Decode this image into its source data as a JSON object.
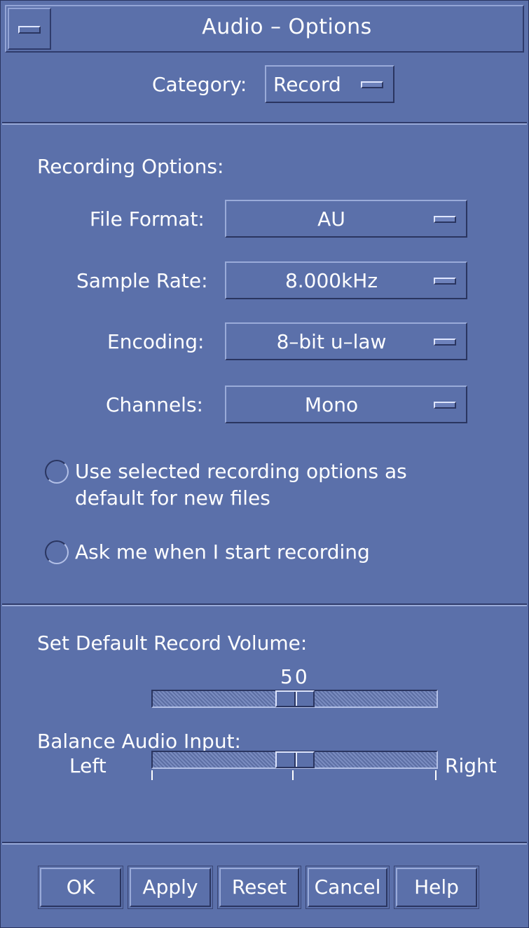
{
  "window": {
    "title": "Audio – Options"
  },
  "category": {
    "label": "Category:",
    "value": "Record"
  },
  "recording": {
    "heading": "Recording Options:",
    "file_format": {
      "label": "File Format:",
      "value": "AU"
    },
    "sample_rate": {
      "label": "Sample Rate:",
      "value": "8.000kHz"
    },
    "encoding": {
      "label": "Encoding:",
      "value": "8–bit u–law"
    },
    "channels": {
      "label": "Channels:",
      "value": "Mono"
    },
    "radio_default_line1": "Use selected recording options as",
    "radio_default_line2": "default for new files",
    "radio_ask": "Ask me when I start recording",
    "radio_default_selected": false,
    "radio_ask_selected": false
  },
  "volume": {
    "heading": "Set Default Record Volume:",
    "value_text": "50",
    "value": 50,
    "max": 100
  },
  "balance": {
    "heading": "Balance Audio Input:",
    "left_label": "Left",
    "right_label": "Right",
    "value": 0.5
  },
  "buttons": {
    "ok": "OK",
    "apply": "Apply",
    "reset": "Reset",
    "cancel": "Cancel",
    "help": "Help"
  },
  "colors": {
    "background": "#5b70aa",
    "text": "#ffffff",
    "shadow": "#2a3560",
    "highlight": "#9aabd9"
  },
  "icons": {
    "window_menu": "window-menu-icon",
    "option_indicator": "option-menu-indicator-icon"
  }
}
